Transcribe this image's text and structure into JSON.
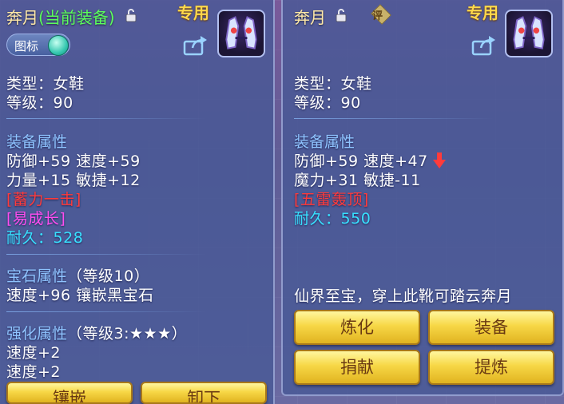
{
  "left_panel": {
    "item_name": "奔月",
    "equipped_tag": "(当前装备)",
    "special_tag": "专用",
    "toggle_label": "图标",
    "type_line": "类型：女鞋",
    "level_line": "等级：90",
    "attr_header": "装备属性",
    "attr_line_1": "防御+59 速度+59",
    "attr_line_2": "力量+15 敏捷+12",
    "skill_1": "[蓄力一击]",
    "skill_2": "[易成长]",
    "durability_label": "耐久：",
    "durability_value": "528",
    "gem_header": "宝石属性",
    "gem_level": "（等级10）",
    "gem_line": "速度+96 镶嵌黑宝石",
    "enhance_header": "强化属性",
    "enhance_level": "（等级3:★★★）",
    "enhance_line_1": "速度+2",
    "enhance_line_2": "速度+2",
    "buttons": [
      "镶嵌",
      "卸下"
    ]
  },
  "right_panel": {
    "item_name": "奔月",
    "review_badge": "评",
    "special_tag": "专用",
    "type_line": "类型：女鞋",
    "level_line": "等级：90",
    "attr_header": "装备属性",
    "attr_line_1": "防御+59 速度+47",
    "attr_line_2": "魔力+31 敏捷-11",
    "skill_1": "[五雷轰顶]",
    "durability_label": "耐久：",
    "durability_value": "550",
    "flavor_text": "仙界至宝，穿上此靴可踏云奔月",
    "buttons": [
      "炼化",
      "装备",
      "捐献",
      "提炼"
    ]
  },
  "colors": {
    "panel_bg": "#4658967",
    "section": "#8fc4ff",
    "equipped": "#5cff5c",
    "special": "#ffd84a",
    "skill_red": "#ff3b3b",
    "skill_magenta": "#ff4ef0",
    "durability": "#38e1ff",
    "button_gold": "#f7d746"
  }
}
